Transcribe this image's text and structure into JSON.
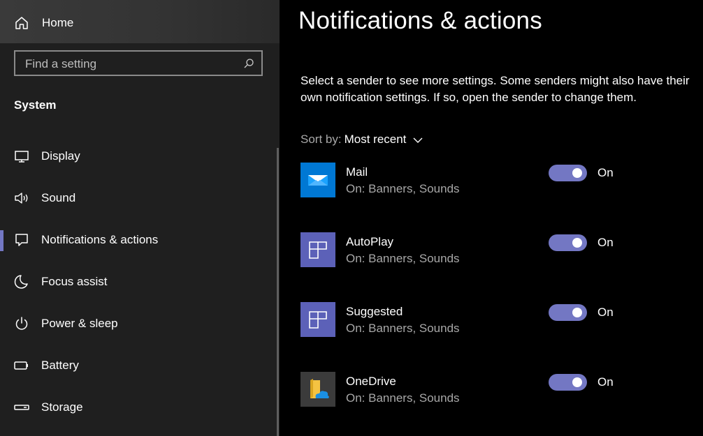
{
  "sidebar": {
    "home_label": "Home",
    "search_placeholder": "Find a setting",
    "section_title": "System",
    "items": [
      {
        "label": "Display",
        "icon": "display-icon"
      },
      {
        "label": "Sound",
        "icon": "sound-icon"
      },
      {
        "label": "Notifications & actions",
        "icon": "notification-icon",
        "active": true
      },
      {
        "label": "Focus assist",
        "icon": "moon-icon"
      },
      {
        "label": "Power & sleep",
        "icon": "power-icon"
      },
      {
        "label": "Battery",
        "icon": "battery-icon"
      },
      {
        "label": "Storage",
        "icon": "storage-icon"
      }
    ]
  },
  "main": {
    "title": "Notifications & actions",
    "description": "Select a sender to see more settings. Some senders might also have their own notification settings. If so, open the sender to change them.",
    "sort_label": "Sort by:",
    "sort_value": "Most recent",
    "senders": [
      {
        "name": "Mail",
        "detail": "On: Banners, Sounds",
        "toggle": "On",
        "icon": "mail-icon"
      },
      {
        "name": "AutoPlay",
        "detail": "On: Banners, Sounds",
        "toggle": "On",
        "icon": "autoplay-icon"
      },
      {
        "name": "Suggested",
        "detail": "On: Banners, Sounds",
        "toggle": "On",
        "icon": "suggested-icon"
      },
      {
        "name": "OneDrive",
        "detail": "On: Banners, Sounds",
        "toggle": "On",
        "icon": "onedrive-icon"
      }
    ]
  },
  "colors": {
    "accent": "#7377c3",
    "sidebar_bg": "#1f1f1f",
    "main_bg": "#000000",
    "mail_blue": "#0078d4",
    "tile_purple": "#5c61b8"
  }
}
